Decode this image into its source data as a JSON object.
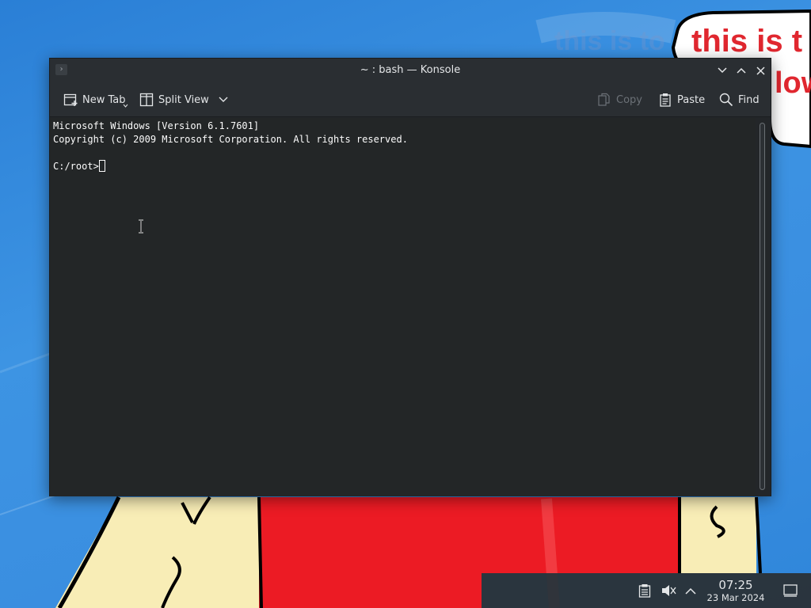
{
  "desktop": {
    "bubble_line1": "this is t",
    "bubble_line2": "low",
    "faint_text": "this is to"
  },
  "window": {
    "title": "~ : bash — Konsole",
    "toolbar": {
      "new_tab": "New Tab",
      "split_view": "Split View",
      "copy": "Copy",
      "paste": "Paste",
      "find": "Find"
    }
  },
  "terminal": {
    "lines": [
      "Microsoft Windows [Version 6.1.7601]",
      "Copyright (c) 2009 Microsoft Corporation. All rights reserved.",
      ""
    ],
    "prompt": "C:/root>"
  },
  "tray": {
    "time": "07:25",
    "date": "23 Mar 2024"
  },
  "colors": {
    "wallpaper_blue": "#3a8ee0",
    "window_bg": "#232629",
    "bubble_text_red": "#e0272f"
  }
}
